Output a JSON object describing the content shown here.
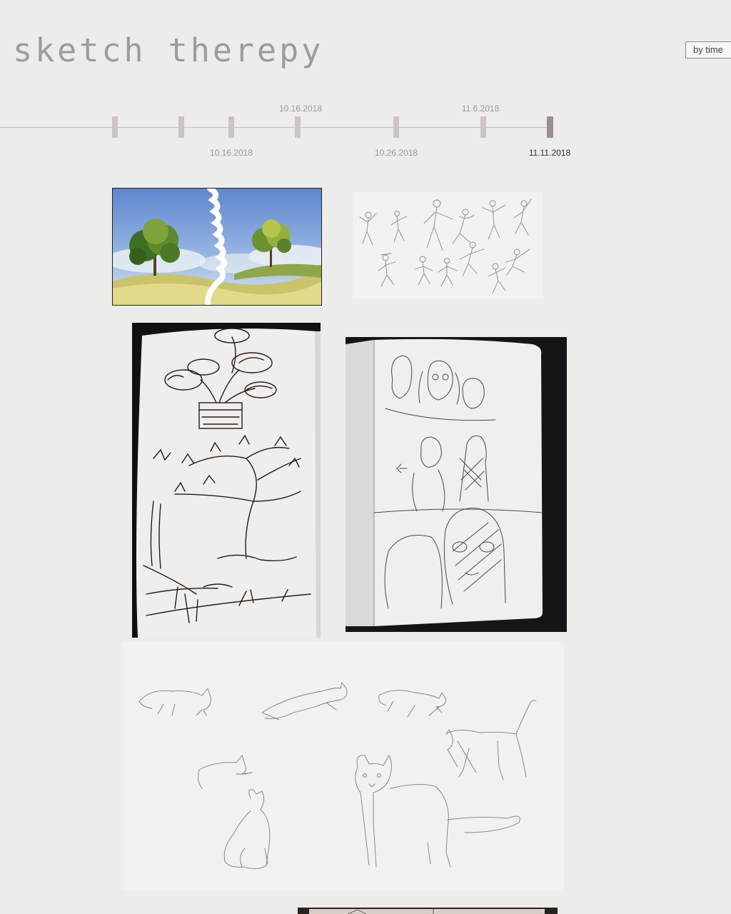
{
  "header": {
    "site_title": "sketch therepy",
    "sort_button_label": "by time"
  },
  "timeline": {
    "labels": {
      "above_1": "10.16.2018",
      "above_2": "11.6.2018",
      "below_1": "10.16.2018",
      "below_2": "10.26.2018",
      "below_3": "11.11.2018"
    },
    "active_date": "11.11.2018"
  },
  "gallery": {
    "items": [
      {
        "subject": "two trees landscape painting"
      },
      {
        "subject": "figure gesture sketches"
      },
      {
        "subject": "bonsai and pine tree ink sketch in notebook"
      },
      {
        "subject": "people portrait pencil sketches in notebook"
      },
      {
        "subject": "cat gesture pencil sketches"
      },
      {
        "subject": "notebook photo (partially visible)"
      }
    ]
  },
  "colors": {
    "background": "#ececea",
    "title": "#9c9c9a",
    "tick": "#cdc3c3",
    "tick_active": "#9c8f8f"
  }
}
